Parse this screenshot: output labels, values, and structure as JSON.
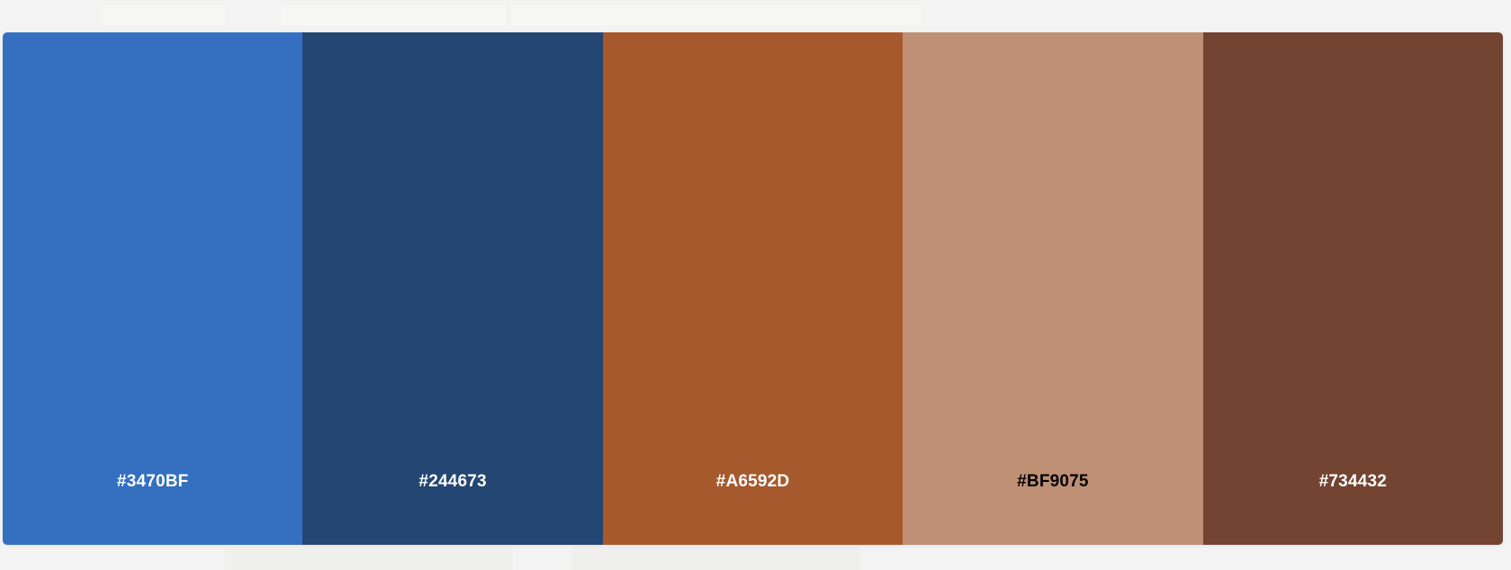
{
  "palette": {
    "colors": [
      {
        "hex": "#3470BF",
        "label": "#3470BF",
        "text_color": "#ffffff"
      },
      {
        "hex": "#244673",
        "label": "#244673",
        "text_color": "#ffffff"
      },
      {
        "hex": "#A6592D",
        "label": "#A6592D",
        "text_color": "#ffffff"
      },
      {
        "hex": "#BF9075",
        "label": "#BF9075",
        "text_color": "#000000"
      },
      {
        "hex": "#734432",
        "label": "#734432",
        "text_color": "#ffffff"
      }
    ]
  }
}
